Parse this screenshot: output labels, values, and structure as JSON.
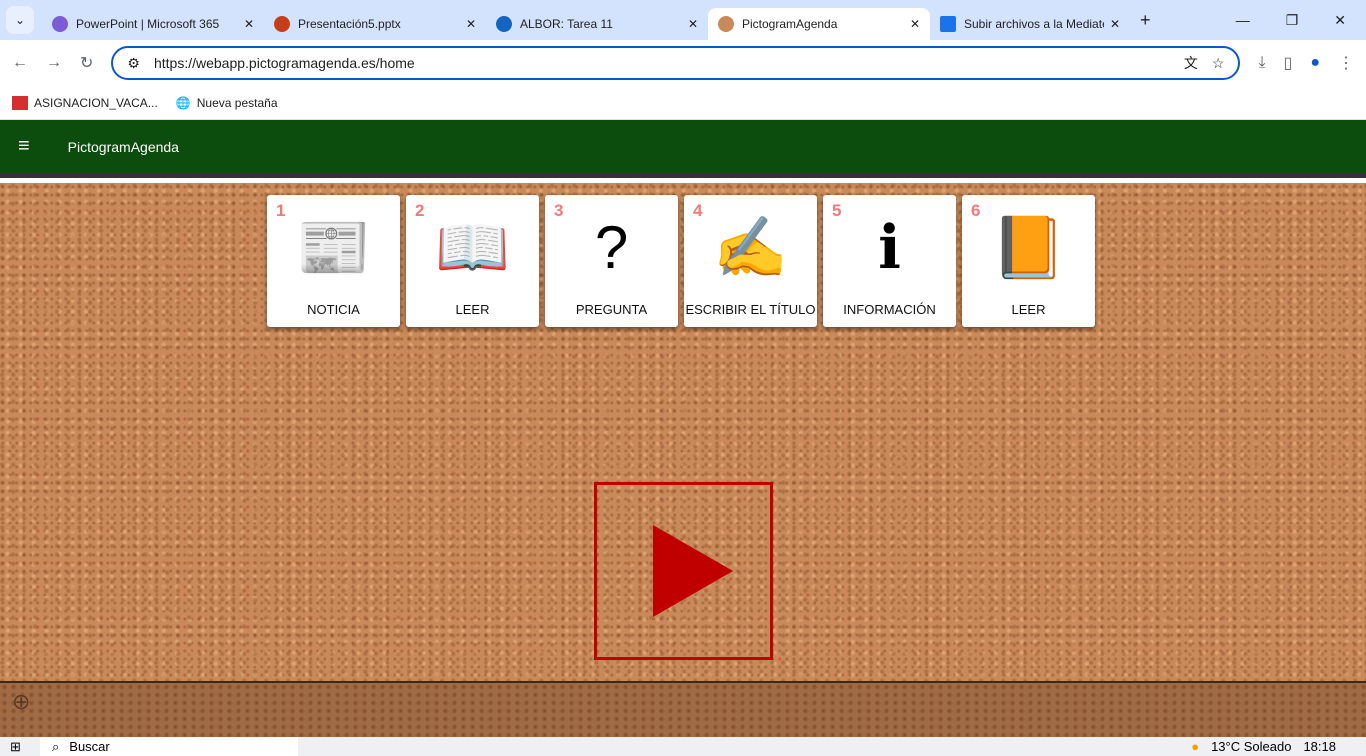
{
  "browser": {
    "tabs": [
      {
        "title": "PowerPoint | Microsoft 365",
        "icon": "microsoft365-icon",
        "color": "#7b5cd6"
      },
      {
        "title": "Presentación5.pptx",
        "icon": "powerpoint-icon",
        "color": "#c43e1c"
      },
      {
        "title": "ALBOR: Tarea 11",
        "icon": "graduation-cap-icon",
        "color": "#1565c0"
      },
      {
        "title": "PictogramAgenda",
        "icon": "pictogramagenda-icon",
        "color": "#c9895a",
        "active": true
      },
      {
        "title": "Subir archivos a la Mediateca",
        "icon": "clapperboard-icon",
        "color": "#1a73e8"
      }
    ],
    "url": "https://webapp.pictogramagenda.es/home",
    "bookmarks": [
      {
        "label": "ASIGNACION_VACA..."
      },
      {
        "label": "Nueva pestaña"
      }
    ]
  },
  "app": {
    "title": "PictogramAgenda"
  },
  "cards": [
    {
      "num": "1",
      "label": "NOTICIA",
      "glyph": "📰"
    },
    {
      "num": "2",
      "label": "LEER",
      "glyph": "📖"
    },
    {
      "num": "3",
      "label": "PREGUNTA",
      "glyph": "?"
    },
    {
      "num": "4",
      "label": "ESCRIBIR EL TÍTULO",
      "glyph": "✍"
    },
    {
      "num": "5",
      "label": "INFORMACIÓN",
      "glyph": "ℹ"
    },
    {
      "num": "6",
      "label": "LEER",
      "glyph": "📙"
    }
  ],
  "taskbar": {
    "search": "Buscar",
    "weather": "13°C  Soleado",
    "time": "18:18"
  }
}
